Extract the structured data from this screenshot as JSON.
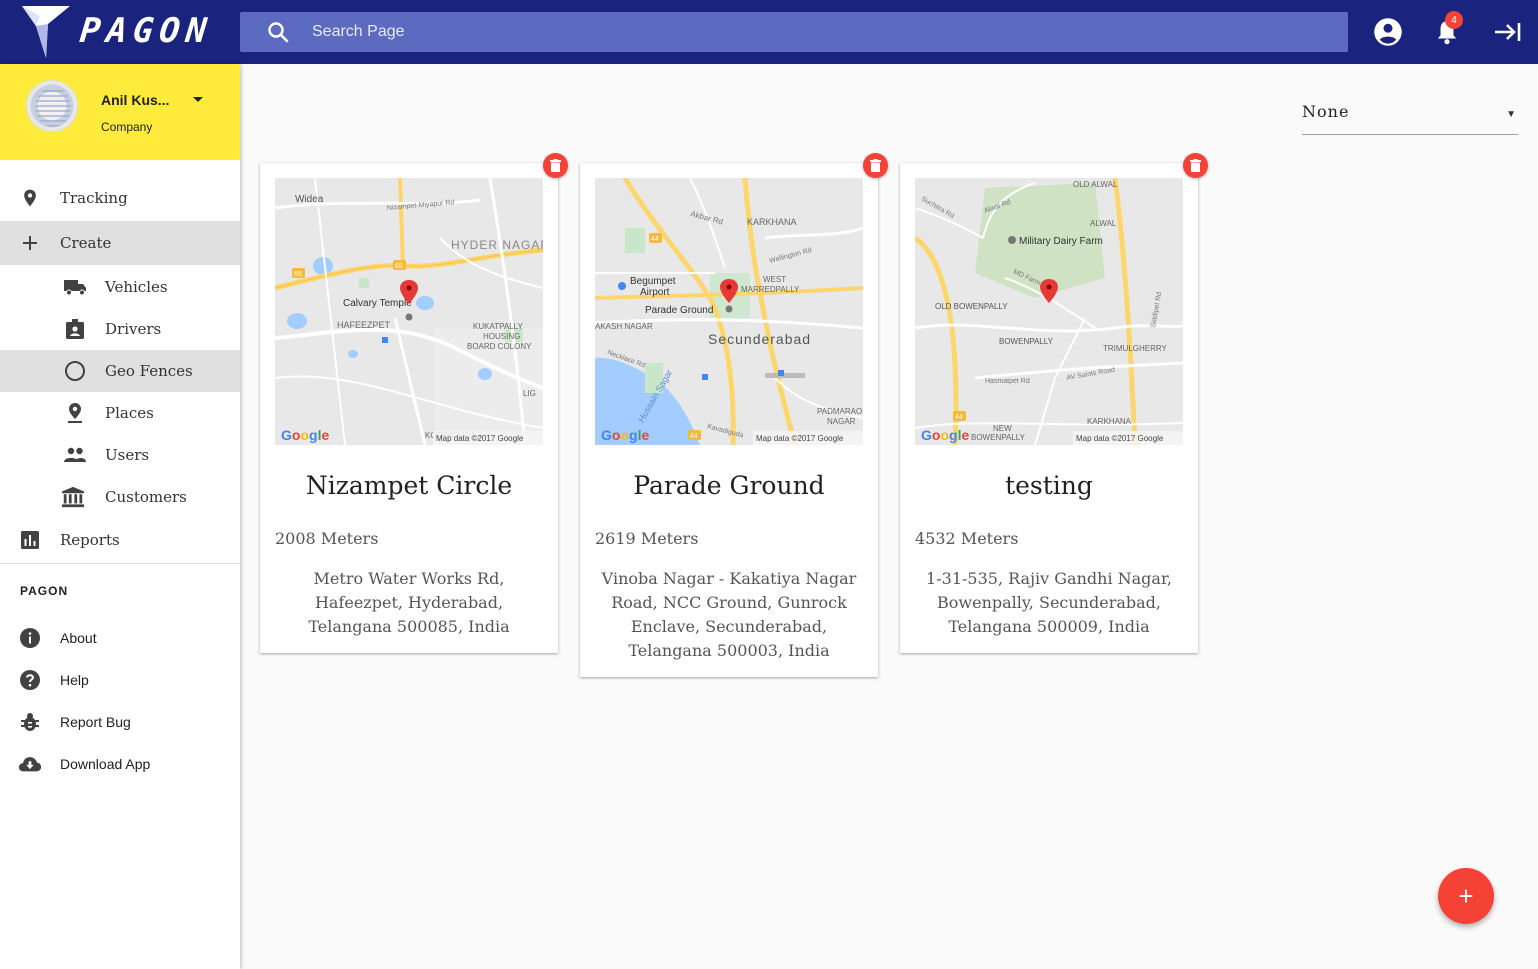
{
  "header": {
    "logo_text": "PAGON",
    "search_placeholder": "Search Page",
    "notification_count": "4"
  },
  "profile": {
    "name": "Anil Kus...",
    "role": "Company"
  },
  "sidebar": {
    "items": [
      {
        "label": "Tracking",
        "icon": "location-pin-icon"
      },
      {
        "label": "Create",
        "icon": "plus-icon"
      },
      {
        "label": "Vehicles",
        "icon": "truck-icon"
      },
      {
        "label": "Drivers",
        "icon": "badge-icon"
      },
      {
        "label": "Geo Fences",
        "icon": "circle-icon"
      },
      {
        "label": "Places",
        "icon": "place-pin-icon"
      },
      {
        "label": "Users",
        "icon": "people-icon"
      },
      {
        "label": "Customers",
        "icon": "bank-icon"
      },
      {
        "label": "Reports",
        "icon": "bar-chart-icon"
      }
    ],
    "section_title": "PAGON",
    "secondary": [
      {
        "label": "About",
        "icon": "info-icon"
      },
      {
        "label": "Help",
        "icon": "help-icon"
      },
      {
        "label": "Report Bug",
        "icon": "bug-icon"
      },
      {
        "label": "Download App",
        "icon": "cloud-download-icon"
      }
    ]
  },
  "filter": {
    "selected": "None"
  },
  "geofences": [
    {
      "title": "Nizampet Circle",
      "radius": "2008 Meters",
      "address": "Metro Water Works Rd, Hafeezpet, Hyderabad, Telangana 500085, India",
      "map_labels": [
        "Widea",
        "Nizampet-Miyapur Rd",
        "HYDER NAGAR",
        "Calvary Temple",
        "HAFEEZPET",
        "KUKATPALLY HOUSING BOARD COLONY",
        "LIG",
        "KOTHAGUDA",
        "65"
      ],
      "map_attribution": "Map data ©2017 Google"
    },
    {
      "title": "Parade Ground",
      "radius": "2619 Meters",
      "address": "Vinoba Nagar - Kakatiya Nagar Road, NCC Ground, Gunrock Enclave, Secunderabad, Telangana 500003, India",
      "map_labels": [
        "Akbar Rd",
        "KARKHANA",
        "Wellington Rd",
        "Begumpet Airport",
        "WEST MARREDPALLY",
        "Parade Ground",
        "AKASH NAGAR",
        "Secunderabad",
        "Necklace Rd",
        "Hussain Sagar",
        "Kavadiguda",
        "PADMARAO NAGAR",
        "44"
      ],
      "map_attribution": "Map data ©2017 Google"
    },
    {
      "title": "testing",
      "radius": "4532 Meters",
      "address": "1-31-535, Rajiv Gandhi Nagar, Bowenpally, Secunderabad, Telangana 500009, India",
      "map_labels": [
        "OLD ALWAL",
        "Suchitra Rd",
        "Alwal Rd",
        "ALWAL",
        "Military Dairy Farm",
        "OLD BOWENPALLY",
        "BOWENPALLY",
        "TRIMULGHERRY",
        "Hasmatpet Rd",
        "AV Saints Road",
        "KARKHANA",
        "NEW BOWENPALLY",
        "44"
      ],
      "map_attribution": "Map data ©2017 Google"
    }
  ],
  "fab_label": "+",
  "map_brand": "Google",
  "colors": {
    "topbar": "#1a237e",
    "search": "#5c6bc0",
    "profile": "#ffeb3b",
    "accent": "#f44336"
  }
}
